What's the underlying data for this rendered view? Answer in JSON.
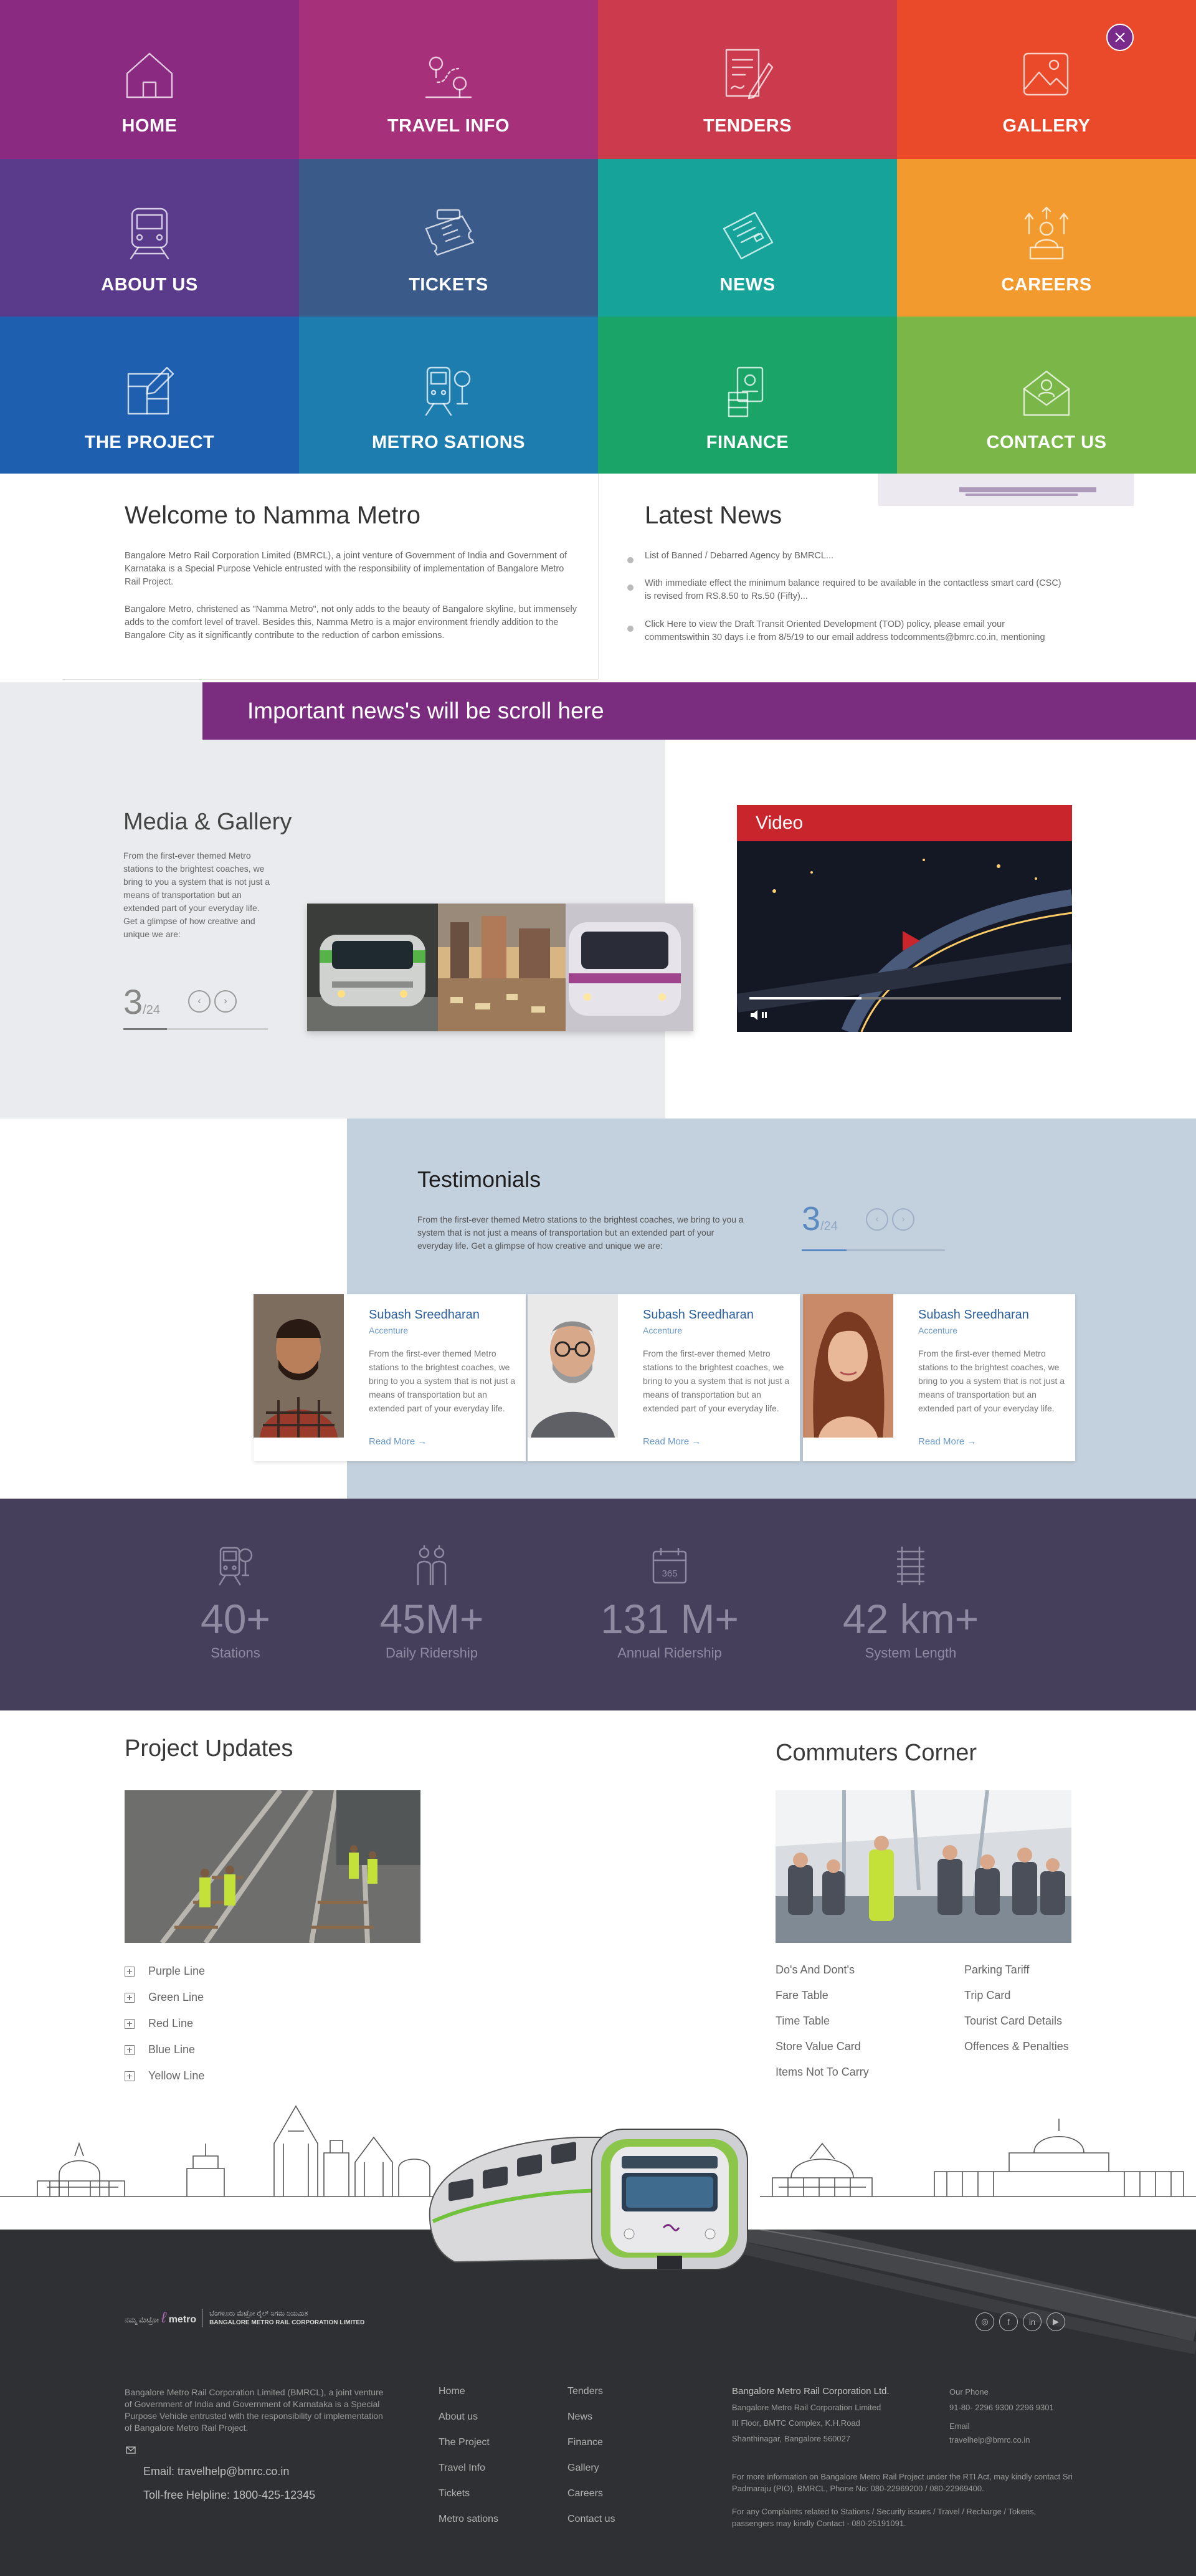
{
  "menu": {
    "close_icon": "close-icon",
    "items": [
      {
        "label": "HOME",
        "icon": "home-icon",
        "color": "#8a2a80"
      },
      {
        "label": "TRAVEL INFO",
        "icon": "map-route-icon",
        "color": "#a7307a"
      },
      {
        "label": "TENDERS",
        "icon": "document-sign-icon",
        "color": "#cc3a4e"
      },
      {
        "label": "GALLERY",
        "icon": "image-icon",
        "color": "#ea4a2a"
      },
      {
        "label": "ABOUT US",
        "icon": "metro-train-icon",
        "color": "#5a3a8a"
      },
      {
        "label": "TICKETS",
        "icon": "ticket-icon",
        "color": "#3a5a8a"
      },
      {
        "label": "NEWS",
        "icon": "newspaper-icon",
        "color": "#15a39a"
      },
      {
        "label": "CAREERS",
        "icon": "career-growth-icon",
        "color": "#f29a2e"
      },
      {
        "label": "THE PROJECT",
        "icon": "blueprint-icon",
        "color": "#1e5fb0"
      },
      {
        "label": "METRO SATIONS",
        "icon": "station-icon",
        "color": "#1d7dae"
      },
      {
        "label": "FINANCE",
        "icon": "finance-icon",
        "color": "#1aa468"
      },
      {
        "label": "CONTACT US",
        "icon": "contact-mail-icon",
        "color": "#7ab648"
      }
    ]
  },
  "welcome": {
    "title": "Welcome to Namma Metro",
    "p1": "Bangalore Metro Rail Corporation Limited (BMRCL), a joint venture of Government of India and Government of Karnataka is a Special Purpose Vehicle entrusted with the responsibility of implementation of Bangalore Metro Rail Project.",
    "p2": "Bangalore Metro, christened as \"Namma Metro\", not only adds to the beauty of Bangalore skyline, but immensely adds to the comfort level of travel. Besides this, Namma Metro is a major environment friendly addition to the Bangalore City as it significantly contribute to the reduction of carbon emissions."
  },
  "news": {
    "title": "Latest News",
    "items": [
      "List of Banned / Debarred Agency by BMRCL...",
      "With immediate effect the minimum balance required to be available in the contactless smart card (CSC) is revised from RS.8.50 to Rs.50 (Fifty)...",
      "Click Here to view the Draft Transit Oriented Development (TOD) policy, please email your commentswithin 30 days i.e from 8/5/19 to our email address todcomments@bmrc.co.in, mentioning"
    ]
  },
  "ticker": {
    "text": "Important news's will be scroll here"
  },
  "media": {
    "title": "Media & Gallery",
    "text": "From the first-ever themed Metro stations to the brightest coaches, we bring to you a system that is not just a means of transportation but an extended part of your everyday life. Get a glimpse of how creative and unique we are:",
    "counter": "3",
    "total": "/24",
    "video_label": "Video"
  },
  "testimonials": {
    "title": "Testimonials",
    "intro": "From the first-ever themed Metro stations to the brightest coaches, we bring to you a system that is not just a means of transportation but an extended part of your everyday life. Get a glimpse of how creative and unique we are:",
    "counter": "3",
    "total": "/24",
    "cards": [
      {
        "name": "Subash Sreedharan",
        "company": "Accenture",
        "text": "From the first-ever themed Metro stations to the brightest coaches, we bring to you a system that is not just a means of transportation but an extended part of your everyday life.",
        "more": "Read More"
      },
      {
        "name": "Subash Sreedharan",
        "company": "Accenture",
        "text": "From the first-ever themed Metro stations to the brightest coaches, we bring to you a system that is not just a means of transportation but an extended part of your everyday life.",
        "more": "Read More"
      },
      {
        "name": "Subash Sreedharan",
        "company": "Accenture",
        "text": "From the first-ever themed Metro stations to the brightest coaches, we bring to you a system that is not just a means of transportation but an extended part of your everyday life.",
        "more": "Read More"
      }
    ]
  },
  "stats": [
    {
      "value": "40+",
      "label": "Stations",
      "icon": "station-icon"
    },
    {
      "value": "45M+",
      "label": "Daily Ridership",
      "icon": "people-icon"
    },
    {
      "value": "131 M+",
      "label": "Annual Ridership",
      "icon": "calendar-365-icon"
    },
    {
      "value": "42 km+",
      "label": "System Length",
      "icon": "track-icon"
    }
  ],
  "project": {
    "title": "Project Updates",
    "lines": [
      "Purple Line",
      "Green Line",
      "Red Line",
      "Blue Line",
      "Yellow Line"
    ]
  },
  "commuters": {
    "title": "Commuters Corner",
    "col1": [
      "Do's And Dont's",
      "Fare Table",
      "Time Table",
      "Store Value Card",
      "Items Not To Carry"
    ],
    "col2": [
      "Parking Tariff",
      "Trip Card",
      "Tourist Card Details",
      "Offences & Penalties"
    ]
  },
  "footer": {
    "logo_text_kn": "ನಮ್ಮ ಮೆಟ್ರೋ",
    "logo_text_en": "metro",
    "logo_corp_kn": "ಬೆಂಗಳೂರು ಮೆಟ್ರೋ ರೈಲ್ ನಿಗಮ ನಿಯಮಿತ",
    "logo_corp_en": "BANGALORE METRO RAIL CORPORATION LIMITED",
    "about": "Bangalore Metro Rail Corporation Limited (BMRCL), a joint venture of Government of India and Government of Karnataka is a Special Purpose Vehicle entrusted with the responsibility of implementation of Bangalore Metro Rail Project.",
    "email": "Email: travelhelp@bmrc.co.in",
    "helpline": "Toll-free Helpline: 1800-425-12345",
    "links_col1": [
      "Home",
      "About us",
      "The Project",
      "Travel Info",
      "Tickets",
      "Metro sations"
    ],
    "links_col2": [
      "Tenders",
      "News",
      "Finance",
      "Gallery",
      "Careers",
      "Contact us"
    ],
    "company_name": "Bangalore Metro Rail Corporation Ltd.",
    "address_lines": [
      "Bangalore Metro Rail Corporation Limited",
      "III Floor, BMTC Complex, K.H.Road",
      "Shanthinagar, Bangalore 560027"
    ],
    "phone_label": "Our Phone",
    "phone": "91-80- 2296 9300 2296 9301",
    "email_label": "Email",
    "email2": "travelhelp@bmrc.co.in",
    "rti": "For more information on Bangalore Metro Rail Project under the RTI Act, may kindly contact Sri Padmaraju (PIO), BMRCL, Phone No: 080-22969200 / 080-22969400.",
    "complaints": "For any Complaints related to Stations / Security issues / Travel / Recharge / Tokens, passengers may kindly Contact - 080-25191091.",
    "social": [
      "instagram-icon",
      "facebook-icon",
      "linkedin-icon",
      "youtube-icon"
    ]
  }
}
